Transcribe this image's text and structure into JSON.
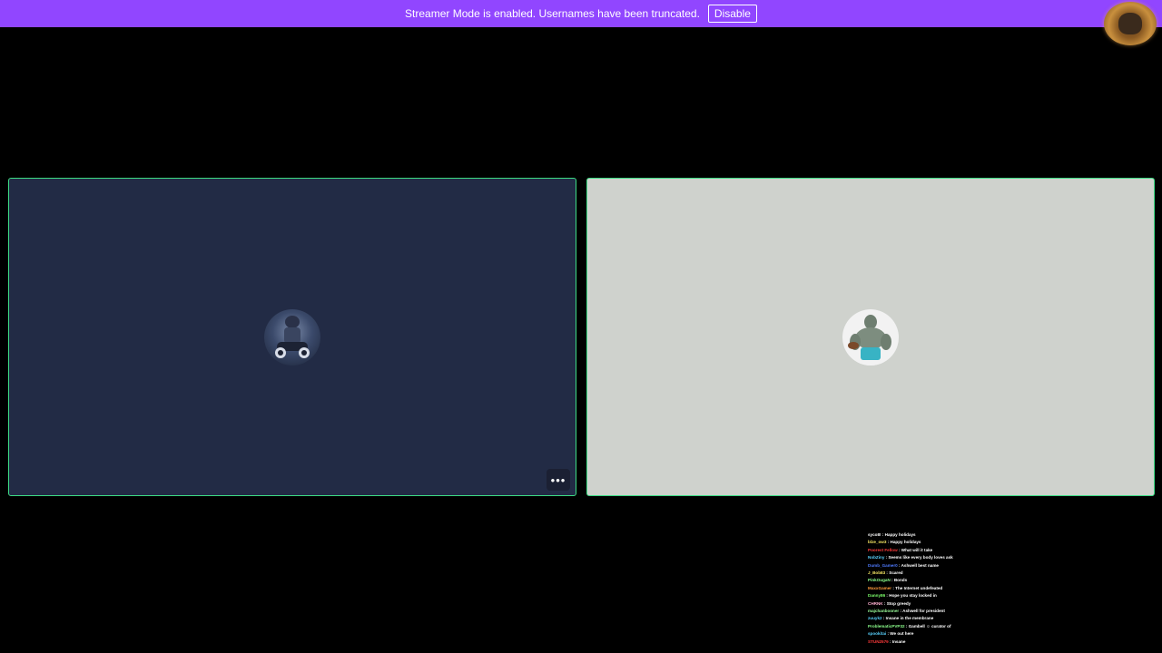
{
  "banner": {
    "message": "Streamer Mode is enabled. Usernames have been truncated.",
    "disable_label": "Disable"
  },
  "colors": {
    "banner": "#9146ff",
    "tile_border": "#3ddc84",
    "left_tile_bg": "#222b45",
    "right_tile_bg": "#cfd2cd"
  },
  "tiles": [
    {
      "avatar": "armored-rider-avatar"
    },
    {
      "avatar": "muscular-figure-avatar"
    }
  ],
  "more_options_label": "•••",
  "chat": [
    {
      "user": "syco8!",
      "color": "#ffffff",
      "message": "Happy holidays"
    },
    {
      "user": "blze_ow3",
      "color": "#f5e663",
      "message": "Happy holidays"
    },
    {
      "user": "Poorest Fellow",
      "color": "#ff3b3b",
      "message": "What will it take"
    },
    {
      "user": "NobZiny",
      "color": "#5ad3ff",
      "message": "Seems like every body loves ask"
    },
    {
      "user": "Dumb_Gamer0",
      "color": "#4f7bff",
      "message": "Ashwell best name"
    },
    {
      "user": "J_Bob83",
      "color": "#f5e663",
      "message": "Scared"
    },
    {
      "user": "PinkOugaN",
      "color": "#8cff8c",
      "message": "Bonds"
    },
    {
      "user": "MaxxGamer",
      "color": "#ff9a3b",
      "message": "The Internet undefeated"
    },
    {
      "user": "Danny86",
      "color": "#7cff6b",
      "message": "Hope you stay locked in"
    },
    {
      "user": "CHRNK",
      "color": "#ffb0d0",
      "message": "Stop greedy"
    },
    {
      "user": "majchanbooner",
      "color": "#9bff9b",
      "message": "Ashwell for president"
    },
    {
      "user": "zuuyk2",
      "color": "#5ad3ff",
      "message": "Insane in the membrane"
    },
    {
      "user": "ProblematicPVP32",
      "color": "#8cff8c",
      "message": "Gambell ☺ curator of"
    },
    {
      "user": "spookitai",
      "color": "#5ad3ff",
      "message": "We out here"
    },
    {
      "user": "STUN2579",
      "color": "#ff3b3b",
      "message": "Insane"
    }
  ]
}
